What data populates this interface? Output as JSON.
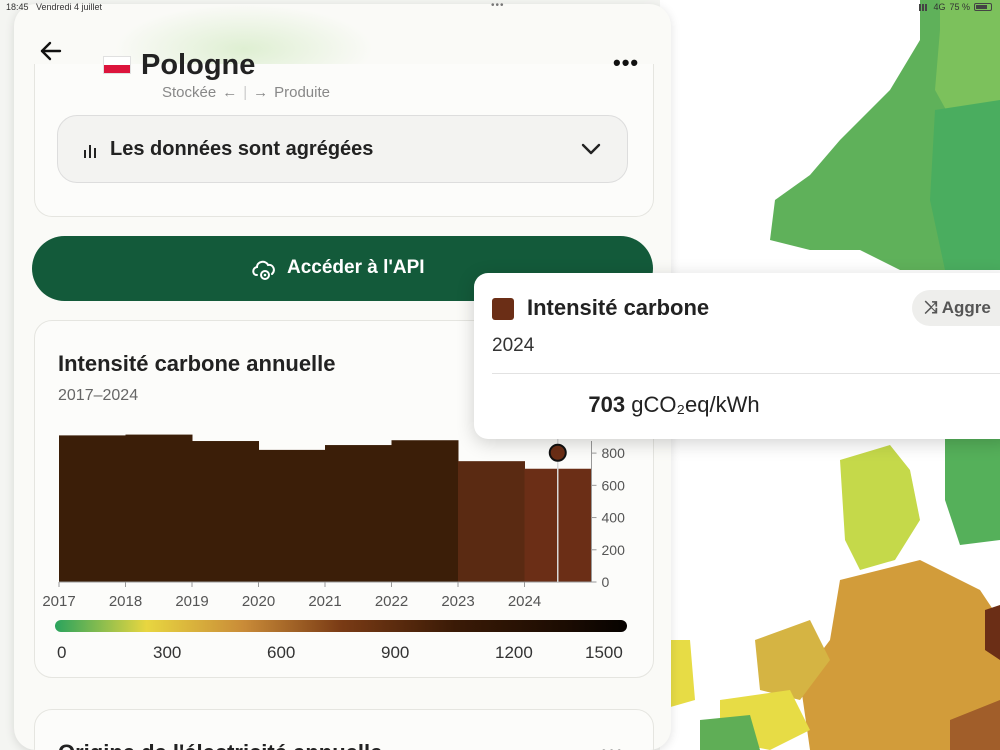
{
  "status_bar": {
    "time": "18:45",
    "date": "Vendredi 4 juillet",
    "network": "4G",
    "battery": "75 %"
  },
  "header": {
    "country": "Pologne",
    "back_icon": "arrow-left-icon",
    "more_icon": "ellipsis-icon"
  },
  "flows": {
    "stored": "Stockée",
    "produced": "Produite"
  },
  "aggregation": {
    "label": "Les données sont agrégées"
  },
  "api_button": {
    "label": "Accéder à l'API"
  },
  "annual_chart": {
    "title": "Intensité carbone annuelle",
    "range": "2017–2024"
  },
  "chart_data": {
    "type": "bar",
    "categories": [
      "2017",
      "2018",
      "2019",
      "2020",
      "2021",
      "2022",
      "2023",
      "2024"
    ],
    "values": [
      910,
      915,
      875,
      820,
      850,
      880,
      750,
      703
    ],
    "ylim": [
      0,
      900
    ],
    "yticks": [
      0,
      200,
      400,
      600,
      800
    ],
    "highlight": {
      "category": "2024",
      "value": 703
    },
    "colors": [
      "#3b1e08",
      "#3b1e08",
      "#3b1e08",
      "#3b1e08",
      "#3b1e08",
      "#3b1e08",
      "#5a2a12",
      "#6b2e16"
    ]
  },
  "color_scale": {
    "labels": [
      "0",
      "300",
      "600",
      "900",
      "1200",
      "1500"
    ]
  },
  "origin_card": {
    "title": "Origine de l'électricité annuelle"
  },
  "tooltip": {
    "title": "Intensité carbone",
    "aggregate_chip": "Aggre",
    "year": "2024",
    "value": "703",
    "unit": "gCO₂eq/kWh"
  }
}
